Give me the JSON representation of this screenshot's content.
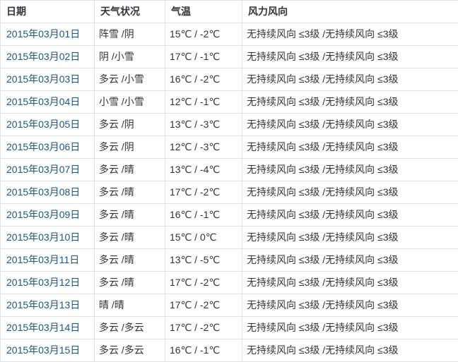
{
  "colors": {
    "link": "#23557e",
    "header_text": "#33333d",
    "body_text": "#333333",
    "border": "#e2e2e2",
    "background": "#ffffff"
  },
  "table": {
    "columns": [
      {
        "key": "date",
        "label": "日期"
      },
      {
        "key": "weather",
        "label": "天气状况"
      },
      {
        "key": "temp",
        "label": "气温"
      },
      {
        "key": "wind",
        "label": "风力风向"
      }
    ],
    "rows": [
      {
        "date": "2015年03月01日",
        "weather": "阵雪 /阴",
        "temp": "15℃ / -2℃",
        "wind": "无持续风向 ≤3级 /无持续风向 ≤3级"
      },
      {
        "date": "2015年03月02日",
        "weather": "阴 /小雪",
        "temp": "17℃ / -1℃",
        "wind": "无持续风向 ≤3级 /无持续风向 ≤3级"
      },
      {
        "date": "2015年03月03日",
        "weather": "多云 /小雪",
        "temp": "16℃ / -2℃",
        "wind": "无持续风向 ≤3级 /无持续风向 ≤3级"
      },
      {
        "date": "2015年03月04日",
        "weather": "小雪 /小雪",
        "temp": "12℃ / -1℃",
        "wind": "无持续风向 ≤3级 /无持续风向 ≤3级"
      },
      {
        "date": "2015年03月05日",
        "weather": "多云 /阴",
        "temp": "13℃ / -3℃",
        "wind": "无持续风向 ≤3级 /无持续风向 ≤3级"
      },
      {
        "date": "2015年03月06日",
        "weather": "多云 /阴",
        "temp": "12℃ / -3℃",
        "wind": "无持续风向 ≤3级 /无持续风向 ≤3级"
      },
      {
        "date": "2015年03月07日",
        "weather": "多云 /晴",
        "temp": "13℃ / -4℃",
        "wind": "无持续风向 ≤3级 /无持续风向 ≤3级"
      },
      {
        "date": "2015年03月08日",
        "weather": "多云 /晴",
        "temp": "17℃ / -2℃",
        "wind": "无持续风向 ≤3级 /无持续风向 ≤3级"
      },
      {
        "date": "2015年03月09日",
        "weather": "多云 /晴",
        "temp": "16℃ / -1℃",
        "wind": "无持续风向 ≤3级 /无持续风向 ≤3级"
      },
      {
        "date": "2015年03月10日",
        "weather": "多云 /晴",
        "temp": "15℃ / 0℃",
        "wind": "无持续风向 ≤3级 /无持续风向 ≤3级"
      },
      {
        "date": "2015年03月11日",
        "weather": "多云 /晴",
        "temp": "13℃ / -5℃",
        "wind": "无持续风向 ≤3级 /无持续风向 ≤3级"
      },
      {
        "date": "2015年03月12日",
        "weather": "多云 /晴",
        "temp": "17℃ / -2℃",
        "wind": "无持续风向 ≤3级 /无持续风向 ≤3级"
      },
      {
        "date": "2015年03月13日",
        "weather": "晴 /晴",
        "temp": "17℃ / -2℃",
        "wind": "无持续风向 ≤3级 /无持续风向 ≤3级"
      },
      {
        "date": "2015年03月14日",
        "weather": "多云 /多云",
        "temp": "17℃ / -2℃",
        "wind": "无持续风向 ≤3级 /无持续风向 ≤3级"
      },
      {
        "date": "2015年03月15日",
        "weather": "多云 /多云",
        "temp": "16℃ / -1℃",
        "wind": "无持续风向 ≤3级 /无持续风向 ≤3级"
      }
    ]
  }
}
